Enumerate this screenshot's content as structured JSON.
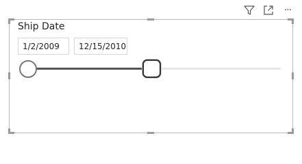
{
  "header": {
    "icons": [
      "filter-icon",
      "focus-mode-icon",
      "more-options-icon"
    ],
    "more_glyph": "···"
  },
  "slicer": {
    "title": "Ship Date",
    "start_date": "1/2/2009",
    "end_date": "12/15/2010",
    "selected_range_fraction": 0.49
  },
  "colors": {
    "frame_border": "#b9b9b9",
    "track": "#e6e6e6",
    "track_fill": "#555555",
    "text": "#252423"
  }
}
